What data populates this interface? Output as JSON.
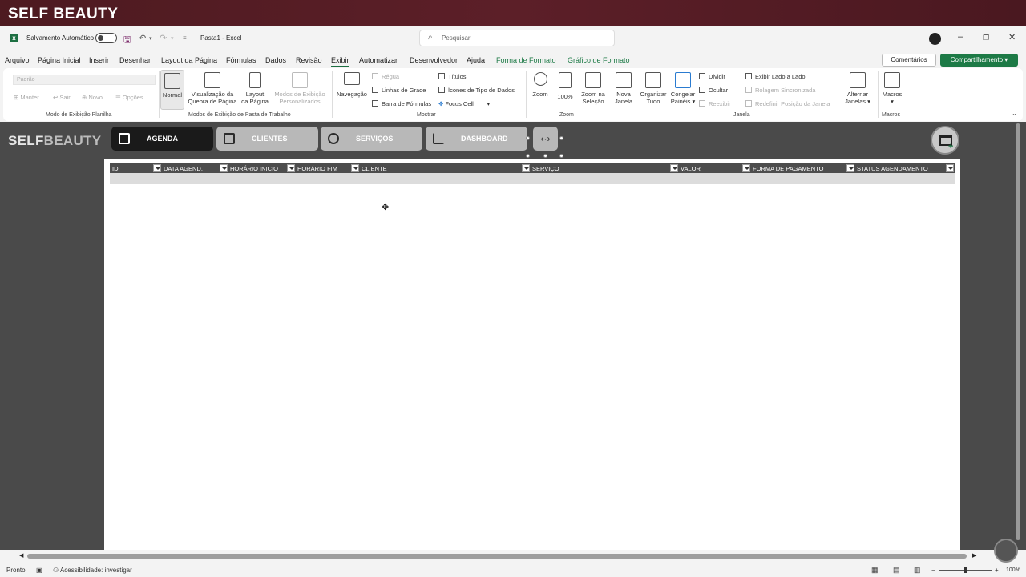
{
  "brand": {
    "title_light": "SELF",
    "title_bold": "BEAUTY"
  },
  "titlebar": {
    "autosave_label": "Salvamento Automático",
    "doc_name": "Pasta1  -  Excel",
    "search_placeholder": "Pesquisar"
  },
  "menu": {
    "tabs": [
      "Arquivo",
      "Página Inicial",
      "Inserir",
      "Desenhar",
      "Layout da Página",
      "Fórmulas",
      "Dados",
      "Revisão",
      "Exibir",
      "Automatizar",
      "Desenvolvedor",
      "Ajuda",
      "Forma de Formato",
      "Gráfico de Formato"
    ],
    "active_tab": "Exibir",
    "comments_label": "Comentários",
    "share_label": "Compartilhamento"
  },
  "ribbon": {
    "sheet_view": {
      "combo_value": "Padrão",
      "keep": "Manter",
      "exit": "Sair",
      "new": "Novo",
      "options": "Opções",
      "group_label": "Modo de Exibição Planilha"
    },
    "workbook_views": {
      "normal": "Normal",
      "page_break_1": "Visualização da",
      "page_break_2": "Quebra de Página",
      "page_layout_1": "Layout",
      "page_layout_2": "da Página",
      "custom_1": "Modos de Exibição",
      "custom_2": "Personalizados",
      "group_label": "Modos de Exibição de Pasta de Trabalho"
    },
    "show": {
      "navigation": "Navegação",
      "ruler": "Régua",
      "gridlines": "Linhas de Grade",
      "formula_bar": "Barra de Fórmulas",
      "headings": "Títulos",
      "data_type_icons": "Ícones de Tipo de Dados",
      "focus_cell": "Focus Cell",
      "group_label": "Mostrar"
    },
    "zoom": {
      "zoom": "Zoom",
      "hundred": "100%",
      "zoom_sel_1": "Zoom na",
      "zoom_sel_2": "Seleção",
      "group_label": "Zoom"
    },
    "window": {
      "new_1": "Nova",
      "new_2": "Janela",
      "arrange_1": "Organizar",
      "arrange_2": "Tudo",
      "freeze_1": "Congelar",
      "freeze_2": "Painéis",
      "split": "Dividir",
      "hide": "Ocultar",
      "unhide": "Reexibir",
      "side_by_side": "Exibir Lado a Lado",
      "sync_scroll": "Rolagem Sincronizada",
      "reset_pos": "Redefinir Posição da Janela",
      "switch_1": "Alternar",
      "switch_2": "Janelas",
      "group_label": "Janela"
    },
    "macros": {
      "label": "Macros",
      "group_label": "Macros"
    }
  },
  "app": {
    "brand_light": "SELF",
    "brand_bold": "BEAUTY",
    "nav": [
      {
        "label": "AGENDA",
        "icon": "calendar-icon",
        "active": true
      },
      {
        "label": "CLIENTES",
        "icon": "id-card-icon",
        "active": false
      },
      {
        "label": "SERVIÇOS",
        "icon": "scissors-icon",
        "active": false
      },
      {
        "label": "DASHBOARD",
        "icon": "bar-chart-icon",
        "active": false
      }
    ],
    "expand_glyph": "‹·›",
    "columns": [
      "ID",
      "DATA AGEND.",
      "HORÁRIO INICIO",
      "HORÁRIO FIM",
      "CLIENTE",
      "SERVIÇO",
      "VALOR",
      "FORMA DE PAGAMENTO",
      "STATUS AGENDAMENTO"
    ]
  },
  "status": {
    "ready": "Pronto",
    "accessibility": "Acessibilidade: investigar",
    "zoom": "100%"
  },
  "colors": {
    "excel_green": "#1d7a46",
    "brand_bar": "#5c1f28",
    "header_dark": "#4d4d4d"
  }
}
